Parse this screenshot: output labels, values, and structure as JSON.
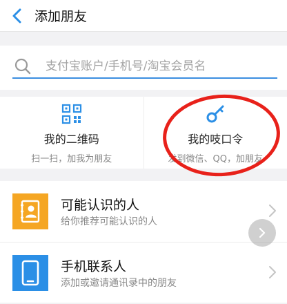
{
  "header": {
    "title": "添加朋友"
  },
  "search": {
    "placeholder": "支付宝账户/手机号/淘宝会员名"
  },
  "actions": [
    {
      "label": "我的二维码",
      "sub": "扫一扫，加我为朋友"
    },
    {
      "label": "我的吱口令",
      "sub": "发到微信、QQ，加朋友"
    }
  ],
  "list": [
    {
      "title": "可能认识的人",
      "sub": "给你推荐可能认识的人",
      "icon_color": "#f5a623"
    },
    {
      "title": "手机联系人",
      "sub": "添加或邀请通讯录中的朋友",
      "icon_color": "#2b8fe6"
    }
  ],
  "colors": {
    "accent": "#3b8ee0",
    "annotation": "#e8211a"
  }
}
